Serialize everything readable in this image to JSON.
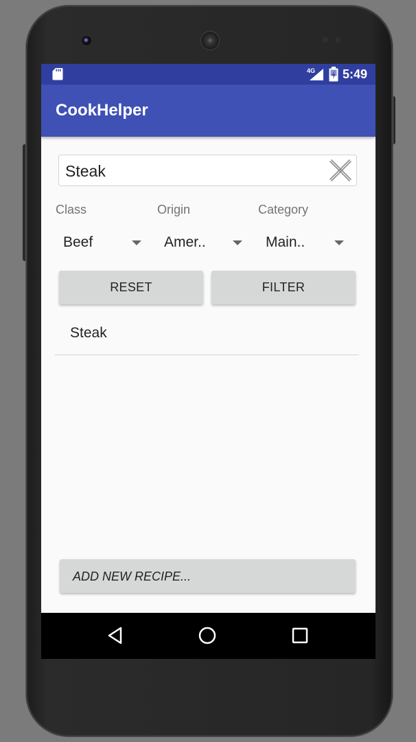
{
  "status_bar": {
    "network": "4G",
    "time": "5:49",
    "icons": [
      "sd-card-icon",
      "signal-icon",
      "battery-icon"
    ]
  },
  "toolbar": {
    "title": "CookHelper"
  },
  "search": {
    "value": "Steak",
    "clear_icon": "close-icon"
  },
  "filters": [
    {
      "label": "Class",
      "value": "Beef"
    },
    {
      "label": "Origin",
      "value": "Amer.."
    },
    {
      "label": "Category",
      "value": "Main.."
    }
  ],
  "buttons": {
    "reset": "RESET",
    "filter": "FILTER",
    "add_new": "ADD NEW RECIPE..."
  },
  "results": [
    {
      "name": "Steak"
    }
  ],
  "nav_bar": {
    "icons": [
      "back-icon",
      "home-icon",
      "recents-icon"
    ]
  },
  "colors": {
    "status_bar": "#303f9f",
    "toolbar": "#3f51b5",
    "background": "#fafafa",
    "button": "#d6d7d7"
  }
}
